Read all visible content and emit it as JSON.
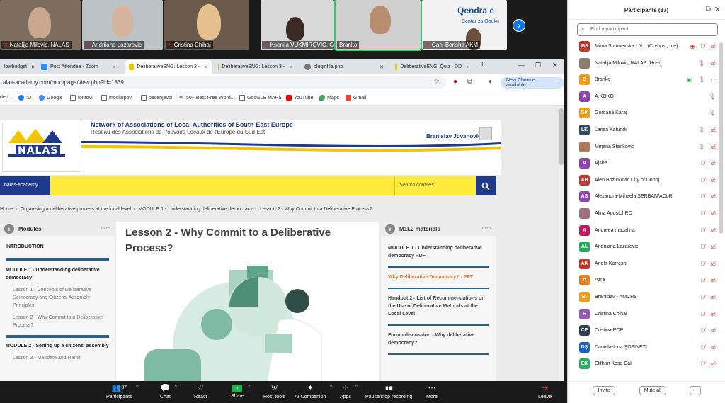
{
  "video_tiles": [
    {
      "name": "Natalija Milovic, NALAS",
      "muted": true
    },
    {
      "name": "Andrijana Lazarevic",
      "muted": true
    },
    {
      "name": "Cristina Chihai",
      "muted": true
    },
    {
      "name": "Ksenija VUKMIROVIC, CoE Po...",
      "muted": true
    },
    {
      "name": "Branko",
      "muted": false
    },
    {
      "name": "Gani Berisha AKM",
      "muted": true
    }
  ],
  "overlay_text": {
    "top": "Qendra e",
    "bottom": "Centar za Obuku"
  },
  "browser": {
    "tabs": [
      {
        "title": "lowbudget",
        "icon_color": "#888"
      },
      {
        "title": "Post Attendee - Zoom",
        "icon_color": "#2d8cff"
      },
      {
        "title": "DeliberativeENG: Lesson 2 -",
        "icon_color": "#f2c500"
      },
      {
        "title": "DeliberativeENG: Lesson 3 -",
        "icon_color": "#f2c500"
      },
      {
        "title": "pluginfile.php",
        "icon_color": "#777"
      },
      {
        "title": "DeliberativeENG: Quiz - DD",
        "icon_color": "#f2c500"
      }
    ],
    "url": "alas-academy.com/mod/page/view.php?id=1839",
    "new_chrome_label": "New Chrome available",
    "bookmarks": [
      "deb...",
      ":D",
      "Google",
      "fontovi",
      "mockupovi",
      "pecenjevci",
      "50+ Best Free Word...",
      "GooGLE MAPS",
      "YouTube",
      "Maps",
      "Gmail"
    ]
  },
  "site": {
    "org_title": "Network of Associations of Local Authorities of South-East Europe",
    "org_subtitle": "Réseau des Associations de Pouvoirs Locaux de l'Europe du Sud-Est",
    "logo_text": "NALAS",
    "user_name": "Branislav Jovanovic",
    "nav_label": "nalas-academy",
    "search_placeholder": "Search courses",
    "breadcrumb": [
      "Home",
      "Organising a deliberative process at the local level",
      "MODULE 1 - Understanding deliberative democracy",
      "Lesson 2 - Why Commit to a Deliberative Process?"
    ],
    "modules_block": {
      "title": "Modules",
      "items": [
        {
          "text": "INTRODUCTION",
          "kind": "heading"
        },
        {
          "text": "MODULE 1 - Understanding deliberative democracy",
          "kind": "heading"
        },
        {
          "text": "Lesson 1 - Concepts of Deliberative Democracy and Citizens' Assembly Principles",
          "kind": "sub"
        },
        {
          "text": "Lesson 2 - Why Commit to a Deliberative Process?",
          "kind": "sub"
        },
        {
          "text": "MODULE 2 - Setting up a citizens' assembly",
          "kind": "heading"
        },
        {
          "text": "Lesson 3 - Mandate and Remit",
          "kind": "sub"
        }
      ]
    },
    "lesson_title": "Lesson 2 - Why Commit to a Deliberative Process?",
    "materials_block": {
      "title": "M1L2 materials",
      "links": [
        {
          "text": "MODULE 1 - Understanding deliberative democracy PDF",
          "highlight": false
        },
        {
          "text": "Why Deliberative Democracy? - PPT",
          "highlight": true
        },
        {
          "text": "Handout 2 - List of Recommendations on the Use of Deliberative Methods at the Local Level",
          "highlight": false
        },
        {
          "text": "Forum discussion - Why deliberative democracy?",
          "highlight": false
        }
      ]
    }
  },
  "zoom_toolbar": {
    "participants_count": "37",
    "buttons": [
      "Participants",
      "Chat",
      "React",
      "Share",
      "Host tools",
      "AI Companion",
      "Apps",
      "Pause/stop recording",
      "More",
      "Leave"
    ]
  },
  "participants_panel": {
    "title": "Participants (37)",
    "search_placeholder": "Find a participant",
    "invite_label": "Invite",
    "mute_all_label": "Mute all",
    "more_label": "···",
    "list": [
      {
        "initials": "MS",
        "name": "Mima Stanoevska - N... (Co-host, me)",
        "color": "#c0392b",
        "status": "muted-recording"
      },
      {
        "initials": "",
        "name": "Natalija Milovic, NALAS (Host)",
        "color": "#8e7c6c",
        "status": "video-off"
      },
      {
        "initials": "B",
        "name": "Branko",
        "color": "#f39c12",
        "status": "video-on"
      },
      {
        "initials": "A",
        "name": "A.KOKO",
        "color": "#8e44ad",
        "status": "mic"
      },
      {
        "initials": "GK",
        "name": "Gordana Karaj",
        "color": "#f39c12",
        "status": "mic"
      },
      {
        "initials": "LK",
        "name": "Larisa Katundi",
        "color": "#34495e",
        "status": "video-off"
      },
      {
        "initials": "",
        "name": "Mirjana Stankovic",
        "color": "#b07a5a",
        "status": "video-off"
      },
      {
        "initials": "A",
        "name": "Ajshe",
        "color": "#8e44ad",
        "status": "muted"
      },
      {
        "initials": "AB",
        "name": "Alen Bozickovic City of Doboj",
        "color": "#c0392b",
        "status": "muted"
      },
      {
        "initials": "AS",
        "name": "Alexandra-Mihaela ŞERBAN/ACoR",
        "color": "#8e44ad",
        "status": "muted"
      },
      {
        "initials": "",
        "name": "Alina Apostol RO",
        "color": "#a07080",
        "status": "muted"
      },
      {
        "initials": "A",
        "name": "Andreea madalina",
        "color": "#c2185b",
        "status": "muted"
      },
      {
        "initials": "AL",
        "name": "Andrijana Lazarevic",
        "color": "#27ae60",
        "status": "muted"
      },
      {
        "initials": "AK",
        "name": "Ariola Korreshi",
        "color": "#c0392b",
        "status": "muted"
      },
      {
        "initials": "A",
        "name": "Azra",
        "color": "#e67e22",
        "status": "muted"
      },
      {
        "initials": "B-",
        "name": "Branislav - AMCRS",
        "color": "#f39c12",
        "status": "muted"
      },
      {
        "initials": "R",
        "name": "Cristina Chihai",
        "color": "#9b59b6",
        "status": "muted"
      },
      {
        "initials": "CP",
        "name": "Cristina POP",
        "color": "#2c3e50",
        "status": "muted"
      },
      {
        "initials": "DŞ",
        "name": "Daniela-Irina ŞOFINEȚI",
        "color": "#1565c0",
        "status": "muted"
      },
      {
        "initials": "EK",
        "name": "Elifhan Kose Cal",
        "color": "#27ae60",
        "status": "muted"
      }
    ]
  }
}
